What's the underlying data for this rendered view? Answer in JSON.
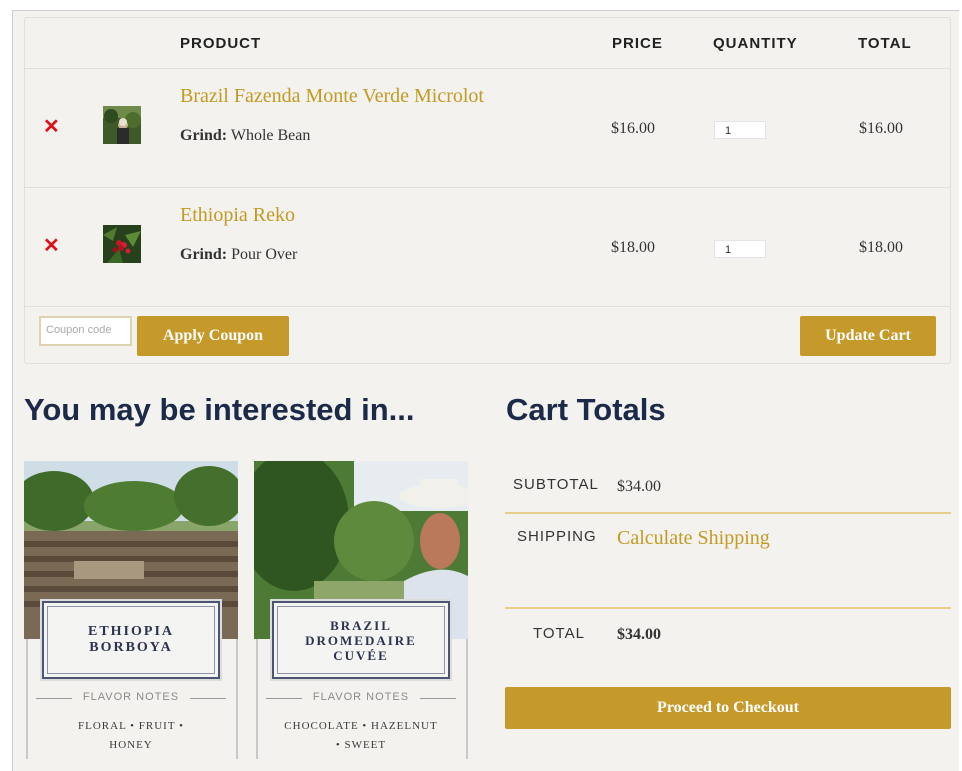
{
  "cart": {
    "headers": {
      "product": "PRODUCT",
      "price": "PRICE",
      "quantity": "QUANTITY",
      "total": "TOTAL"
    },
    "items": [
      {
        "name": "Brazil Fazenda Monte Verde Microlot",
        "grind_label": "Grind:",
        "grind_value": "Whole Bean",
        "price": "$16.00",
        "quantity": "1",
        "total": "$16.00",
        "remove_icon": "close-icon"
      },
      {
        "name": "Ethiopia Reko",
        "grind_label": "Grind:",
        "grind_value": "Pour Over",
        "price": "$18.00",
        "quantity": "1",
        "total": "$18.00",
        "remove_icon": "close-icon"
      }
    ],
    "coupon_placeholder": "Coupon code",
    "apply_coupon_label": "Apply Coupon",
    "update_cart_label": "Update Cart"
  },
  "interested": {
    "heading": "You may be interested in...",
    "products": [
      {
        "name_line1": "ETHIOPIA",
        "name_line2": "BORBOYA",
        "name_line3": "",
        "notes_title": "FLAVOR NOTES",
        "notes_line1": "FLORAL • FRUIT •",
        "notes_line2": "HONEY"
      },
      {
        "name_line1": "BRAZIL",
        "name_line2": "DROMEDAIRE",
        "name_line3": "CUVÉE",
        "notes_title": "FLAVOR NOTES",
        "notes_line1": "CHOCOLATE • HAZELNUT",
        "notes_line2": "• SWEET"
      }
    ]
  },
  "totals": {
    "heading": "Cart Totals",
    "subtotal_label": "SUBTOTAL",
    "subtotal_value": "$34.00",
    "shipping_label": "SHIPPING",
    "shipping_link": "Calculate Shipping",
    "total_label": "TOTAL",
    "total_value": "$34.00",
    "checkout_label": "Proceed to Checkout"
  },
  "colors": {
    "gold": "#c59a2a",
    "product_link": "#c39a23",
    "heading_navy": "#1c2a4a",
    "remove_red": "#e0101a",
    "background": "#f3f2ee"
  }
}
